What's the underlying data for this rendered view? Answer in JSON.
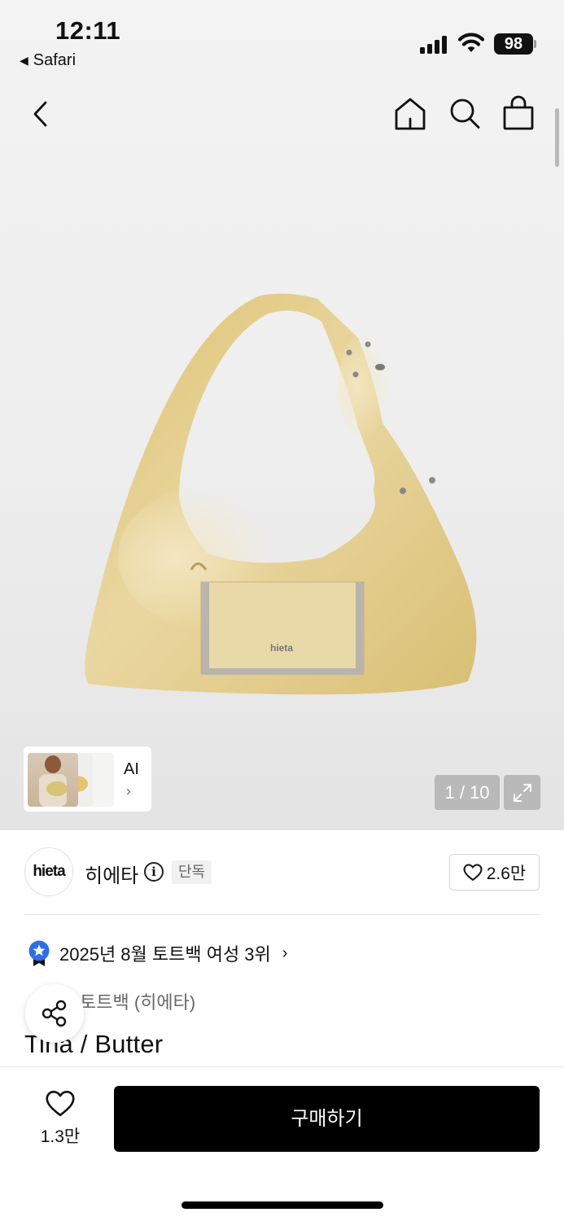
{
  "status": {
    "time": "12:11",
    "back_app": "Safari",
    "battery": "98"
  },
  "icons": {
    "back": "chevron-left-icon",
    "home": "home-icon",
    "search": "search-icon",
    "bag": "shopping-bag-icon",
    "expand": "expand-icon",
    "info": "info-icon",
    "heart": "heart-icon",
    "share": "share-icon",
    "ranking": "ranking-medal-icon"
  },
  "gallery": {
    "ai_label": "AI",
    "ai_chevron": "›",
    "page_counter": "1 / 10"
  },
  "brand": {
    "logo_text": "hieta",
    "name": "히에타",
    "info_glyph": "i",
    "badge": "단독",
    "likes": "2.6만"
  },
  "ranking": {
    "text": "2025년 8월 토트백 여성 3위",
    "chevron": "›"
  },
  "category": "토트백 (히에타)",
  "product_name": "Tina / Butter",
  "bottom": {
    "wishlist_count": "1.3만",
    "buy_label": "구매하기"
  },
  "colors": {
    "accent_blue": "#2f6ee8",
    "bag_yellow": "#e5cd7f",
    "buy_button": "#000000"
  }
}
